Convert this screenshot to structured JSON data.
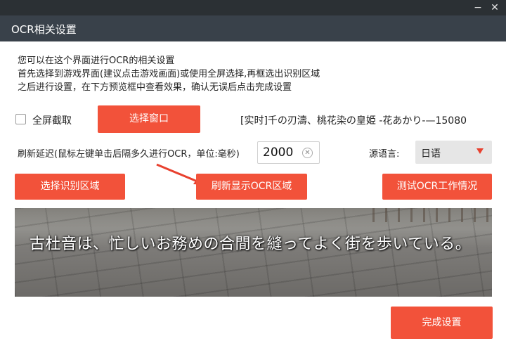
{
  "window": {
    "title": "OCR相关设置",
    "minimize_icon": "minimize-icon",
    "close_icon": "close-icon"
  },
  "description": {
    "line1": "您可以在这个界面进行OCR的相关设置",
    "line2": "首先选择到游戏界面(建议点击游戏画面)或使用全屏选择,再框选出识别区域",
    "line3": "之后进行设置，在下方预览框中查看效果，确认无误后点击完成设置"
  },
  "capture": {
    "fullscreen_label": "全屏截取",
    "fullscreen_checked": false,
    "select_window_label": "选择窗口",
    "window_title": "[实时]千の刃濤、桃花染の皇姫 -花あかり-—15080"
  },
  "delay": {
    "label": "刷新延迟(鼠标左键单击后隔多久进行OCR，单位:毫秒)",
    "value": "2000"
  },
  "language": {
    "label": "源语言:",
    "selected": "日语"
  },
  "actions": {
    "select_region": "选择识别区域",
    "refresh_region": "刷新显示OCR区域",
    "test_ocr": "测试OCR工作情况",
    "finish": "完成设置"
  },
  "preview": {
    "text": "古杜音は、忙しいお務めの合間を縫ってよく街を歩いている。"
  },
  "colors": {
    "accent": "#f2523a",
    "titlebar": "#39414a",
    "arrow": "#e8412f"
  }
}
